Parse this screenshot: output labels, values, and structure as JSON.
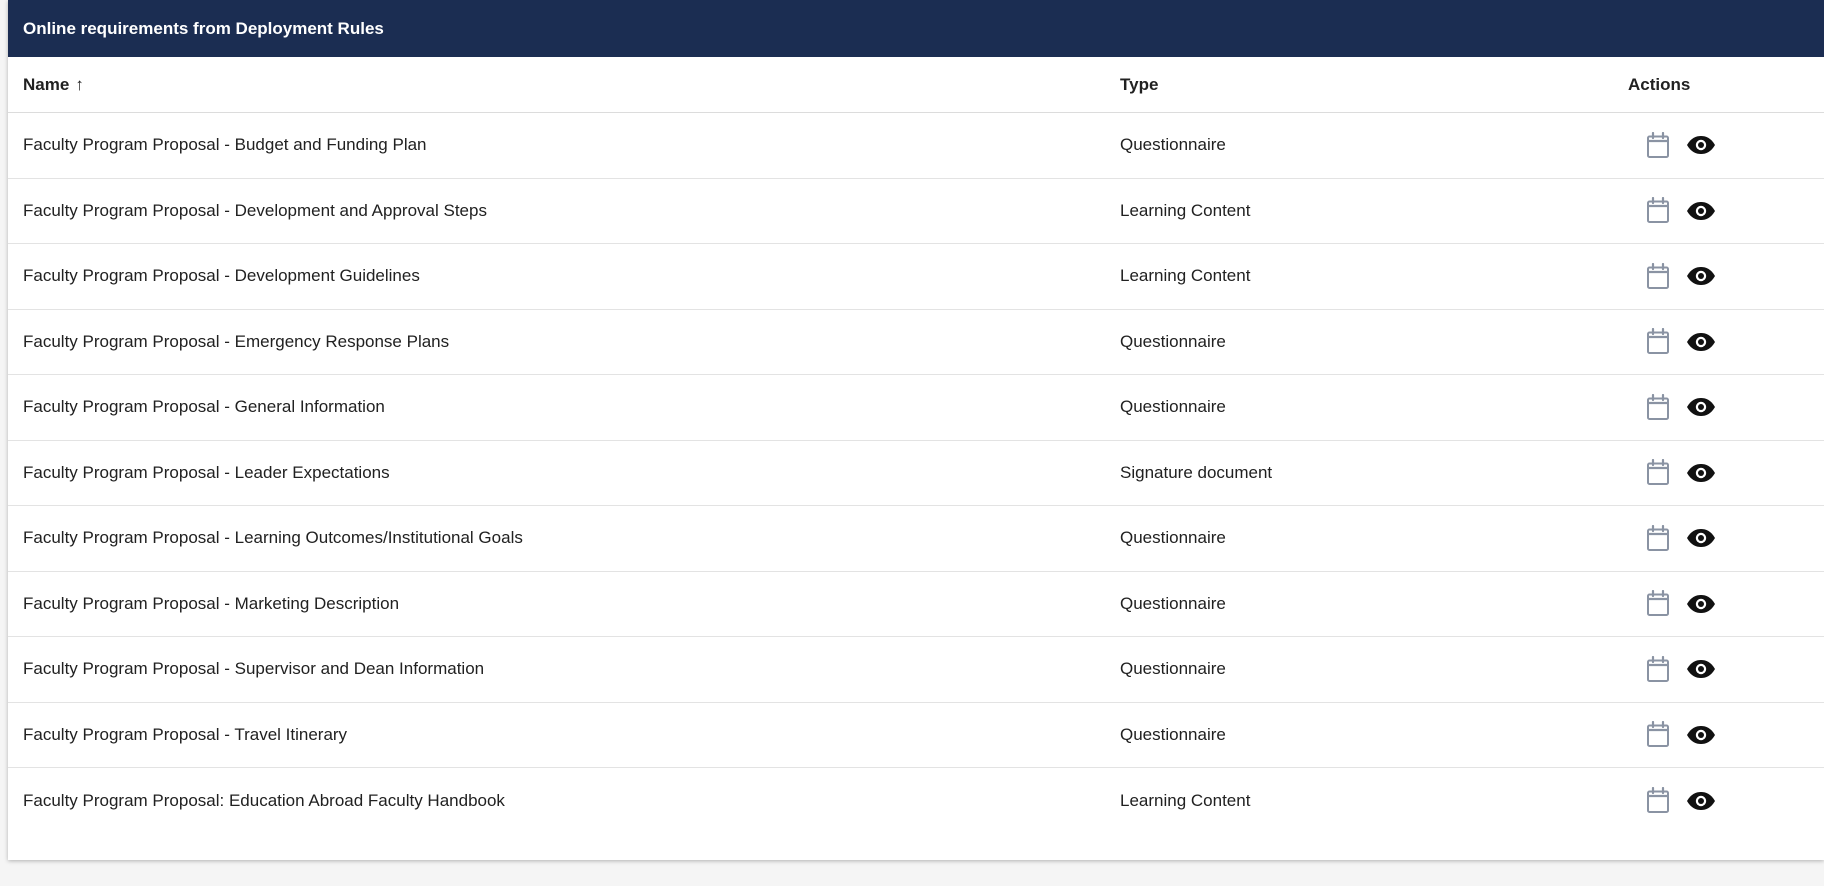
{
  "panel": {
    "title": "Online requirements from Deployment Rules"
  },
  "table": {
    "columns": {
      "name": "Name",
      "name_sort_indicator": "↑",
      "type": "Type",
      "actions": "Actions"
    },
    "rows": [
      {
        "name": "Faculty Program Proposal - Budget and Funding Plan",
        "type": "Questionnaire"
      },
      {
        "name": "Faculty Program Proposal - Development and Approval Steps",
        "type": "Learning Content"
      },
      {
        "name": "Faculty Program Proposal - Development Guidelines",
        "type": "Learning Content"
      },
      {
        "name": "Faculty Program Proposal - Emergency Response Plans",
        "type": "Questionnaire"
      },
      {
        "name": "Faculty Program Proposal - General Information",
        "type": "Questionnaire"
      },
      {
        "name": "Faculty Program Proposal - Leader Expectations",
        "type": "Signature document"
      },
      {
        "name": "Faculty Program Proposal - Learning Outcomes/Institutional Goals",
        "type": "Questionnaire"
      },
      {
        "name": "Faculty Program Proposal - Marketing Description",
        "type": "Questionnaire"
      },
      {
        "name": "Faculty Program Proposal - Supervisor and Dean Information",
        "type": "Questionnaire"
      },
      {
        "name": "Faculty Program Proposal - Travel Itinerary",
        "type": "Questionnaire"
      },
      {
        "name": "Faculty Program Proposal: Education Abroad Faculty Handbook",
        "type": "Learning Content"
      }
    ],
    "row_actions": [
      {
        "icon": "calendar-icon"
      },
      {
        "icon": "eye-icon"
      }
    ]
  },
  "colors": {
    "header_bg": "#1b2d52",
    "calendar_icon": "#8a93a3",
    "eye_icon": "#111111"
  }
}
